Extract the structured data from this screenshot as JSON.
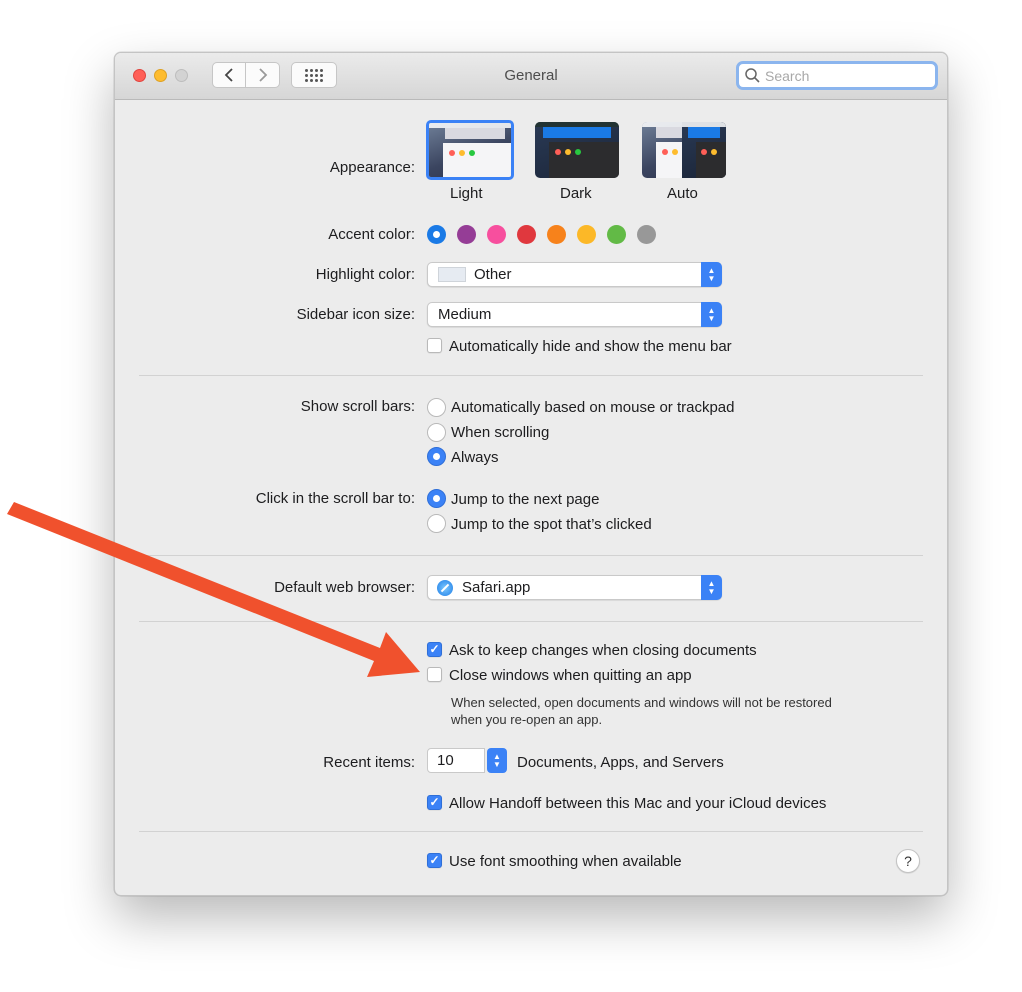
{
  "window": {
    "title": "General"
  },
  "search": {
    "placeholder": "Search"
  },
  "appearance": {
    "label": "Appearance:",
    "options": [
      {
        "label": "Light",
        "selected": true
      },
      {
        "label": "Dark",
        "selected": false
      },
      {
        "label": "Auto",
        "selected": false
      }
    ]
  },
  "accent": {
    "label": "Accent color:",
    "colors": [
      "#1a7ae6",
      "#953d96",
      "#f74f9e",
      "#e0383e",
      "#f7821b",
      "#fcb827",
      "#62ba46",
      "#989898"
    ],
    "selected_index": 0
  },
  "highlight": {
    "label": "Highlight color:",
    "value": "Other"
  },
  "sidebar_icon": {
    "label": "Sidebar icon size:",
    "value": "Medium"
  },
  "menu_bar": {
    "label": "Automatically hide and show the menu bar",
    "checked": false
  },
  "scroll_bars": {
    "label": "Show scroll bars:",
    "options": [
      {
        "label": "Automatically based on mouse or trackpad",
        "selected": false
      },
      {
        "label": "When scrolling",
        "selected": false
      },
      {
        "label": "Always",
        "selected": true
      }
    ]
  },
  "scroll_click": {
    "label": "Click in the scroll bar to:",
    "options": [
      {
        "label": "Jump to the next page",
        "selected": true
      },
      {
        "label": "Jump to the spot that’s clicked",
        "selected": false
      }
    ]
  },
  "browser": {
    "label": "Default web browser:",
    "value": "Safari.app"
  },
  "ask_keep": {
    "label": "Ask to keep changes when closing documents",
    "checked": true
  },
  "close_windows": {
    "label": "Close windows when quitting an app",
    "checked": false,
    "note_line1": "When selected, open documents and windows will not be restored",
    "note_line2": "when you re-open an app."
  },
  "recent": {
    "label": "Recent items:",
    "value": "10",
    "suffix": "Documents, Apps, and Servers"
  },
  "handoff": {
    "label": "Allow Handoff between this Mac and your iCloud devices",
    "checked": true
  },
  "font_smoothing": {
    "label": "Use font smoothing when available",
    "checked": true
  },
  "help": {
    "label": "?"
  },
  "check_glyph": "✓",
  "arrow": {
    "color": "#f0512d"
  }
}
